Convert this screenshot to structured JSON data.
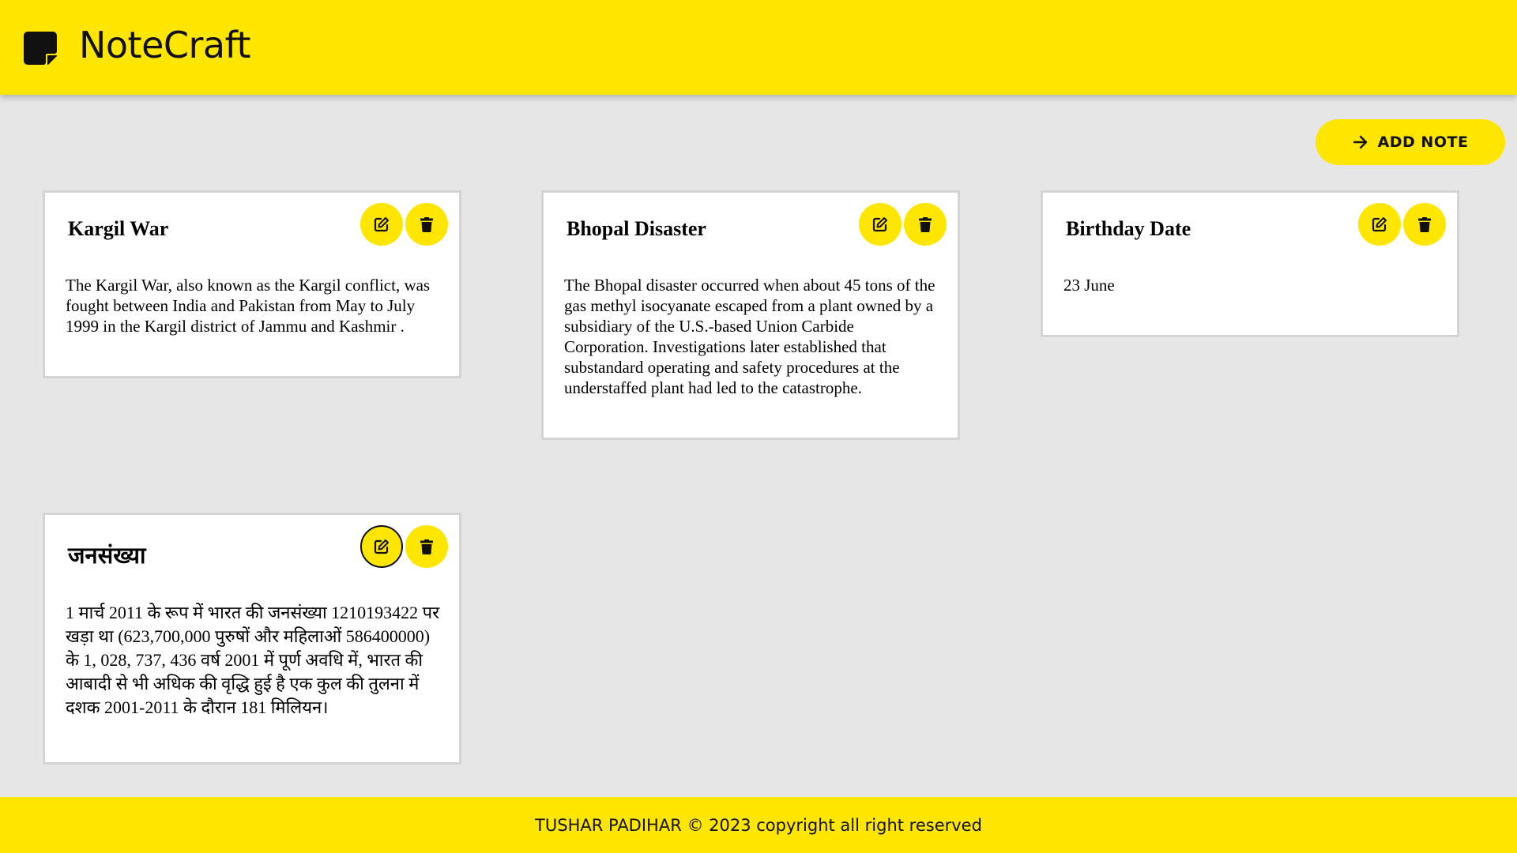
{
  "header": {
    "logo_icon": "sticky-note-icon",
    "title": "NoteCraft",
    "accent_color": "#ffe600"
  },
  "toolbar": {
    "add_note_label": "ADD NOTE",
    "add_note_icon": "arrow-right-icon"
  },
  "notes": [
    {
      "title": "Kargil War",
      "body": "The Kargil War, also known as the Kargil conflict, was fought between India and Pakistan from May to July 1999 in the Kargil district of Jammu and Kashmir .",
      "edit_icon": "edit-icon",
      "delete_icon": "trash-icon"
    },
    {
      "title": "Bhopal Disaster",
      "body": "The Bhopal disaster occurred when about 45 tons of the gas methyl isocyanate escaped from a plant owned by a subsidiary of the U.S.-based Union Carbide Corporation. Investigations later established that substandard operating and safety procedures at the understaffed plant had led to the catastrophe.",
      "edit_icon": "edit-icon",
      "delete_icon": "trash-icon"
    },
    {
      "title": "Birthday Date",
      "body": "23 June",
      "edit_icon": "edit-icon",
      "delete_icon": "trash-icon"
    },
    {
      "title": "जनसंख्या",
      "body": "1 मार्च 2011 के रूप में भारत की जनसंख्या 1210193422 पर खड़ा था (623,700,000 पुरुषों और महिलाओं 586400000) के 1, 028, 737, 436 वर्ष 2001 में पूर्ण अवधि में, भारत की आबादी से भी अधिक की वृद्धि हुई है एक कुल की तुलना में दशक 2001-2011 के दौरान 181 मिलियन।",
      "edit_icon": "edit-icon",
      "delete_icon": "trash-icon"
    }
  ],
  "footer": {
    "text": "TUSHAR PADIHAR © 2023 copyright all right reserved"
  }
}
